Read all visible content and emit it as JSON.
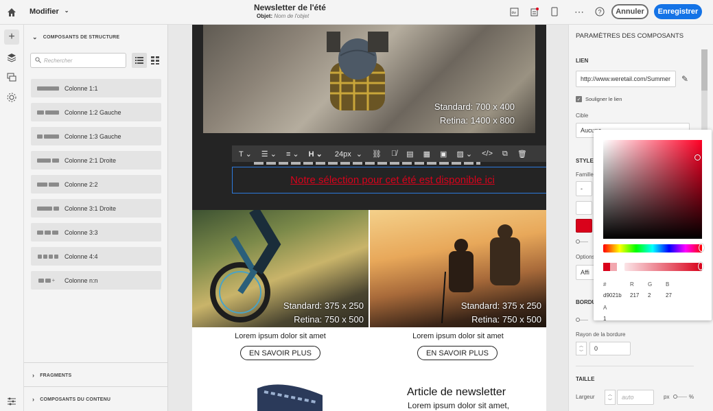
{
  "topbar": {
    "mode_label": "Modifier",
    "title": "Newsletter de l'été",
    "subject_label": "Objet:",
    "subject_placeholder": "Nom de l'objet",
    "cancel_label": "Annuler",
    "save_label": "Enregistrer"
  },
  "left_panel": {
    "structure_title": "COMPOSANTS DE STRUCTURE",
    "search_placeholder": "Rechercher",
    "components": [
      {
        "label": "Colonne 1:1"
      },
      {
        "label": "Colonne 1:2 Gauche"
      },
      {
        "label": "Colonne 1:3 Gauche"
      },
      {
        "label": "Colonne 2:1 Droite"
      },
      {
        "label": "Colonne 2:2"
      },
      {
        "label": "Colonne 3:1 Droite"
      },
      {
        "label": "Colonne 3:3"
      },
      {
        "label": "Colonne 4:4"
      },
      {
        "label": "Colonne n:n"
      }
    ],
    "fragments_title": "FRAGMENTS",
    "content_title": "COMPOSANTS DU CONTENU"
  },
  "email": {
    "hero_standard": "Standard: 700 x 400",
    "hero_retina": "Retina: 1400 x 800",
    "toolbar_fontsize": "24px",
    "link_text": "Notre sélection pour cet été est disponible ici",
    "img_left_standard": "Standard: 375 x 250",
    "img_left_retina": "Retina: 750 x 500",
    "img_right_standard": "Standard: 375 x 250",
    "img_right_retina": "Retina: 750 x 500",
    "caption_left": "Lorem ipsum dolor sit amet",
    "caption_right": "Lorem ipsum dolor sit amet",
    "button_left": "EN SAVOIR PLUS",
    "button_right": "EN SAVOIR PLUS",
    "article_title": "Article de newsletter",
    "article_text": "Lorem ipsum dolor sit amet,"
  },
  "right_panel": {
    "title": "PARAMÈTRES DES COMPOSANTS",
    "lien_label": "LIEN",
    "url_value": "http://www.weretail.com/Summer",
    "underline_label": "Souligner le lien",
    "cible_label": "Cible",
    "cible_value": "Aucune",
    "style_label": "STYLE",
    "famille_label": "Famille",
    "famille_value": "-",
    "options_label": "Options",
    "options_value": "Affi",
    "bordure_label": "BORDU",
    "rayon_label": "Rayon de la bordure",
    "rayon_value": "0",
    "taille_label": "TAILLE",
    "largeur_label": "Largeur",
    "largeur_placeholder": "auto",
    "unit_px": "px",
    "unit_pct": "%"
  },
  "color_picker": {
    "hex_label": "#",
    "r_label": "R",
    "g_label": "G",
    "b_label": "B",
    "a_label": "A",
    "hex_value": "d9021b",
    "r_value": "217",
    "g_value": "2",
    "b_value": "27",
    "a_value": "1",
    "accent_color": "#d9021b"
  },
  "colors": {
    "primary": "#1473e6",
    "link_red": "#d9021b"
  }
}
